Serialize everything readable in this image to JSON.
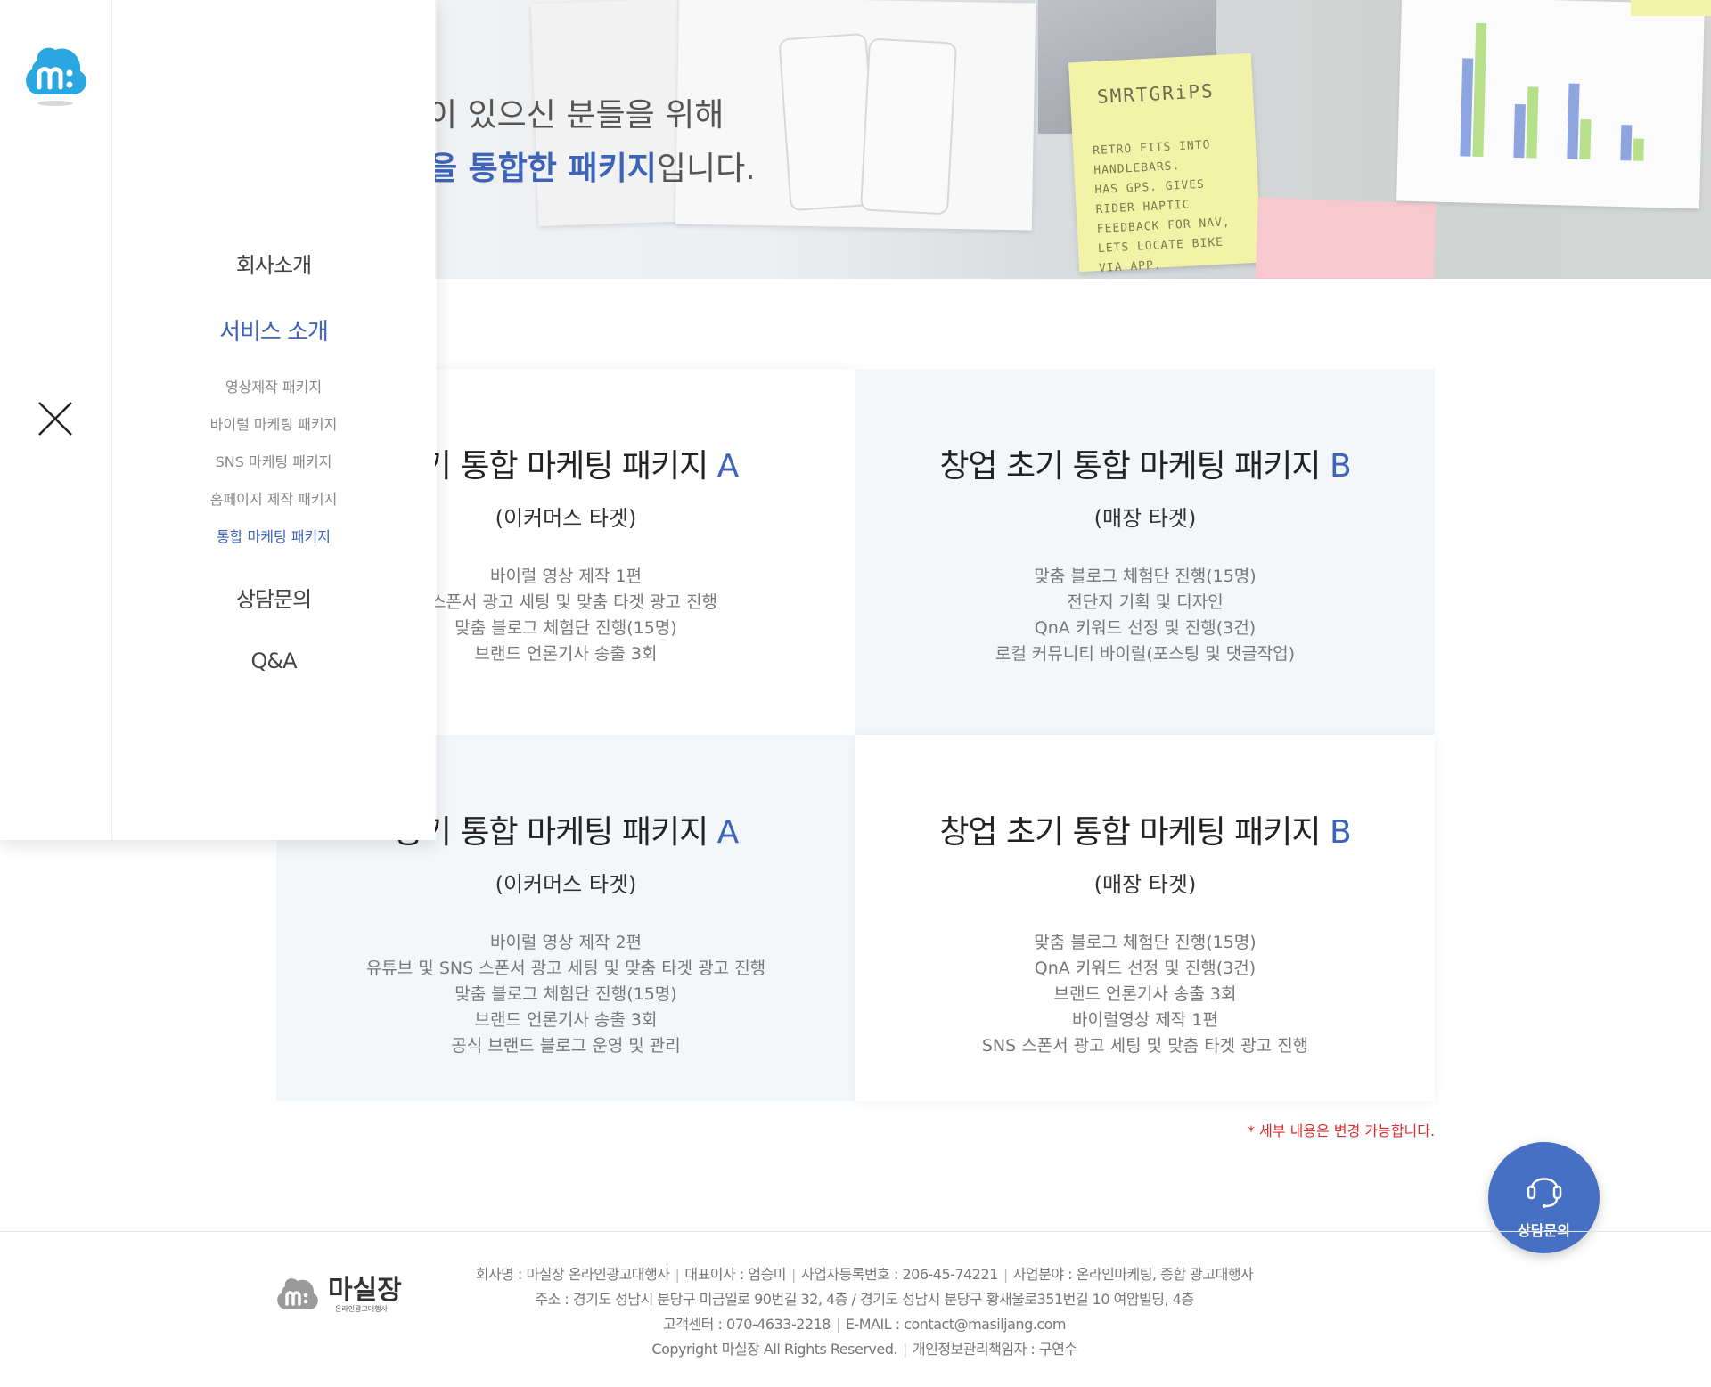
{
  "hero": {
    "line1": "이 있으신 분들을 위해",
    "line2_highlight": "을 통합한 패키지",
    "line2_rest": "입니다.",
    "sticky_title": "SMRTGRiPS",
    "sticky_lines": [
      "RETRO FITS INTO",
      "HANDLEBARS.",
      "HAS GPS. GIVES",
      "RIDER HAPTIC",
      "FEEDBACK FOR NAV,",
      "LETS LOCATE BIKE",
      "VIA APP."
    ]
  },
  "sidebar": {
    "logo": "masiljang-logo",
    "close_icon": "close-icon",
    "menu": [
      {
        "label": "회사소개",
        "active": false
      },
      {
        "label": "서비스 소개",
        "active": true
      },
      {
        "label": "상담문의",
        "active": false
      },
      {
        "label": "Q&A",
        "active": false
      }
    ],
    "submenu": [
      {
        "label": "영상제작 패키지",
        "active": false
      },
      {
        "label": "바이럴 마케팅 패키지",
        "active": false
      },
      {
        "label": "SNS 마케팅 패키지",
        "active": false
      },
      {
        "label": "홈페이지 제작 패키지",
        "active": false
      },
      {
        "label": "통합 마케팅 패키지",
        "active": true
      }
    ]
  },
  "packages": [
    {
      "title": "초기 통합 마케팅 패키지",
      "letter": "A",
      "subtitle": "(이커머스 타겟)",
      "items": [
        "바이럴 영상 제작 1편",
        "S 스폰서 광고 세팅 및 맞춤 타겟 광고 진행",
        "맞춤 블로그 체험단 진행(15명)",
        "브랜드 언론기사 송출 3회"
      ]
    },
    {
      "title": "창업 초기 통합 마케팅 패키지",
      "letter": "B",
      "subtitle": "(매장 타겟)",
      "items": [
        "맞춤 블로그 체험단 진행(15명)",
        "전단지 기획 및 디자인",
        "QnA 키워드 선정 및 진행(3건)",
        "로컬 커뮤니티 바이럴(포스팅 및 댓글작업)"
      ]
    },
    {
      "title": "중기 통합 마케팅 패키지",
      "letter": "A",
      "subtitle": "(이커머스 타겟)",
      "items": [
        "바이럴 영상 제작 2편",
        "유튜브 및 SNS 스폰서 광고 세팅 및 맞춤 타겟 광고 진행",
        "맞춤 블로그 체험단 진행(15명)",
        "브랜드 언론기사 송출 3회",
        "공식 브랜드 블로그 운영 및 관리"
      ]
    },
    {
      "title": "창업 초기 통합 마케팅 패키지",
      "letter": "B",
      "subtitle": "(매장 타겟)",
      "items": [
        "맞춤 블로그 체험단 진행(15명)",
        "QnA 키워드 선정 및 진행(3건)",
        "브랜드 언론기사 송출 3회",
        "바이럴영상 제작 1편",
        "SNS 스폰서 광고 세팅 및 맞춤 타겟 광고 진행"
      ]
    }
  ],
  "note": "* 세부 내용은 변경 가능합니다.",
  "consult_button": {
    "label": "상담문의",
    "icon": "headset-icon"
  },
  "footer": {
    "logo_text": "마실장",
    "logo_subtext": "온라인광고대행사",
    "line1": [
      "회사명 : 마실장 온라인광고대행사",
      "대표이사 : 엄승미",
      "사업자등록번호 : 206-45-74221",
      "사업분야 : 온라인마케팅, 종합 광고대행사"
    ],
    "line2": "주소 : 경기도 성남시 분당구 미금일로 90번길 32, 4층 / 경기도 성남시 분당구 황새울로351번길 10 여암빌딩, 4층",
    "line3": [
      "고객센터 : 070-4633-2218",
      "E-MAIL : contact@masiljang.com"
    ],
    "line4": [
      "Copyright 마실장 All Rights Reserved.",
      "개인정보관리책임자 : 구연수"
    ]
  },
  "colors": {
    "accent": "#3d64b8",
    "button": "#4570c4",
    "note": "#e02b2b",
    "card_blue": "#f4f7fa"
  }
}
